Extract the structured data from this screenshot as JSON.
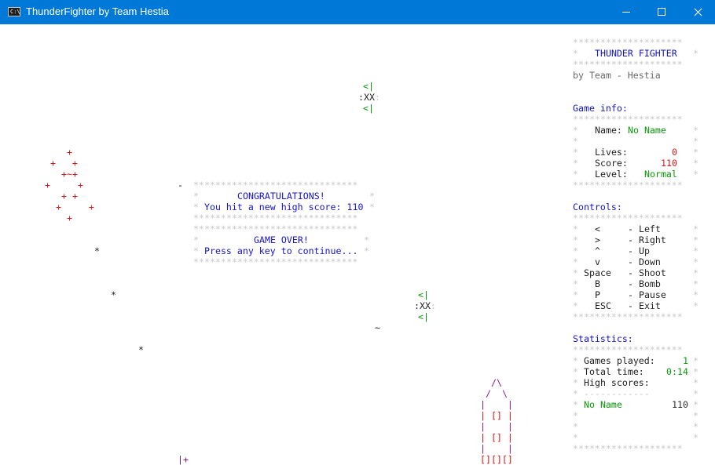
{
  "window": {
    "title": "ThunderFighter by Team Hestia"
  },
  "colors": {
    "titlebar": "#0078d7",
    "text": "#222222",
    "border": "#c8c8c8",
    "heading": "#1414d2",
    "good": "#0a9a0a",
    "bad": "#e01414",
    "ship": "#8c1a8c"
  },
  "icons": {
    "app": "console-icon",
    "minimize": "minimize-icon",
    "maximize": "maximize-icon",
    "close": "close-icon"
  },
  "panel": {
    "stars": "********************",
    "title_line": "*   THUNDER FIGHTER  *",
    "title": "THUNDER FIGHTER",
    "team": "by Team - Hestia",
    "game_info_header": "Game info:",
    "blank": "*                  *",
    "name_label": "Name:",
    "name_value": "No Name",
    "lives_label": "Lives:",
    "lives_value": "0",
    "score_label": "Score:",
    "score_value": "110",
    "level_label": "Level:",
    "level_value": "Normal",
    "controls_header": "Controls:",
    "controls": [
      {
        "key": "<",
        "action": "- Left"
      },
      {
        "key": ">",
        "action": "- Right"
      },
      {
        "key": "^",
        "action": "- Up"
      },
      {
        "key": "v",
        "action": "- Down"
      },
      {
        "key": "Space",
        "action": "- Shoot"
      },
      {
        "key": "B",
        "action": "- Bomb"
      },
      {
        "key": "P",
        "action": "- Pause"
      },
      {
        "key": "ESC",
        "action": "- Exit"
      }
    ],
    "statistics_header": "Statistics:",
    "games_played_label": "Games played:",
    "games_played_value": "1",
    "total_time_label": "Total time:",
    "total_time_value": "0:14",
    "high_scores_label": "High scores:",
    "dash_line": "------------",
    "high_score_name": "No Name",
    "high_score_value": "110"
  },
  "dialog": {
    "border": "******************************",
    "congrats": "CONGRATULATIONS!",
    "high_score_msg": "You hit a new high score: 110",
    "game_over": "GAME OVER!",
    "press_key": "Press any key to continue..."
  },
  "sprites": {
    "enemy_top": "<|",
    "enemy_body": ":XX",
    "enemy_tail": ":",
    "explosion_rows": [
      "+",
      "+   +",
      "+~+",
      "+     +",
      "+ +",
      "+     +",
      "+"
    ],
    "star": "*",
    "tilde": "~",
    "dash": "-",
    "bullet": "|+",
    "ship_rows": [
      "/\\",
      "/  \\",
      "|    |",
      "| [] |",
      "|    |",
      "| [] |",
      "|    |",
      "[][][]"
    ]
  }
}
